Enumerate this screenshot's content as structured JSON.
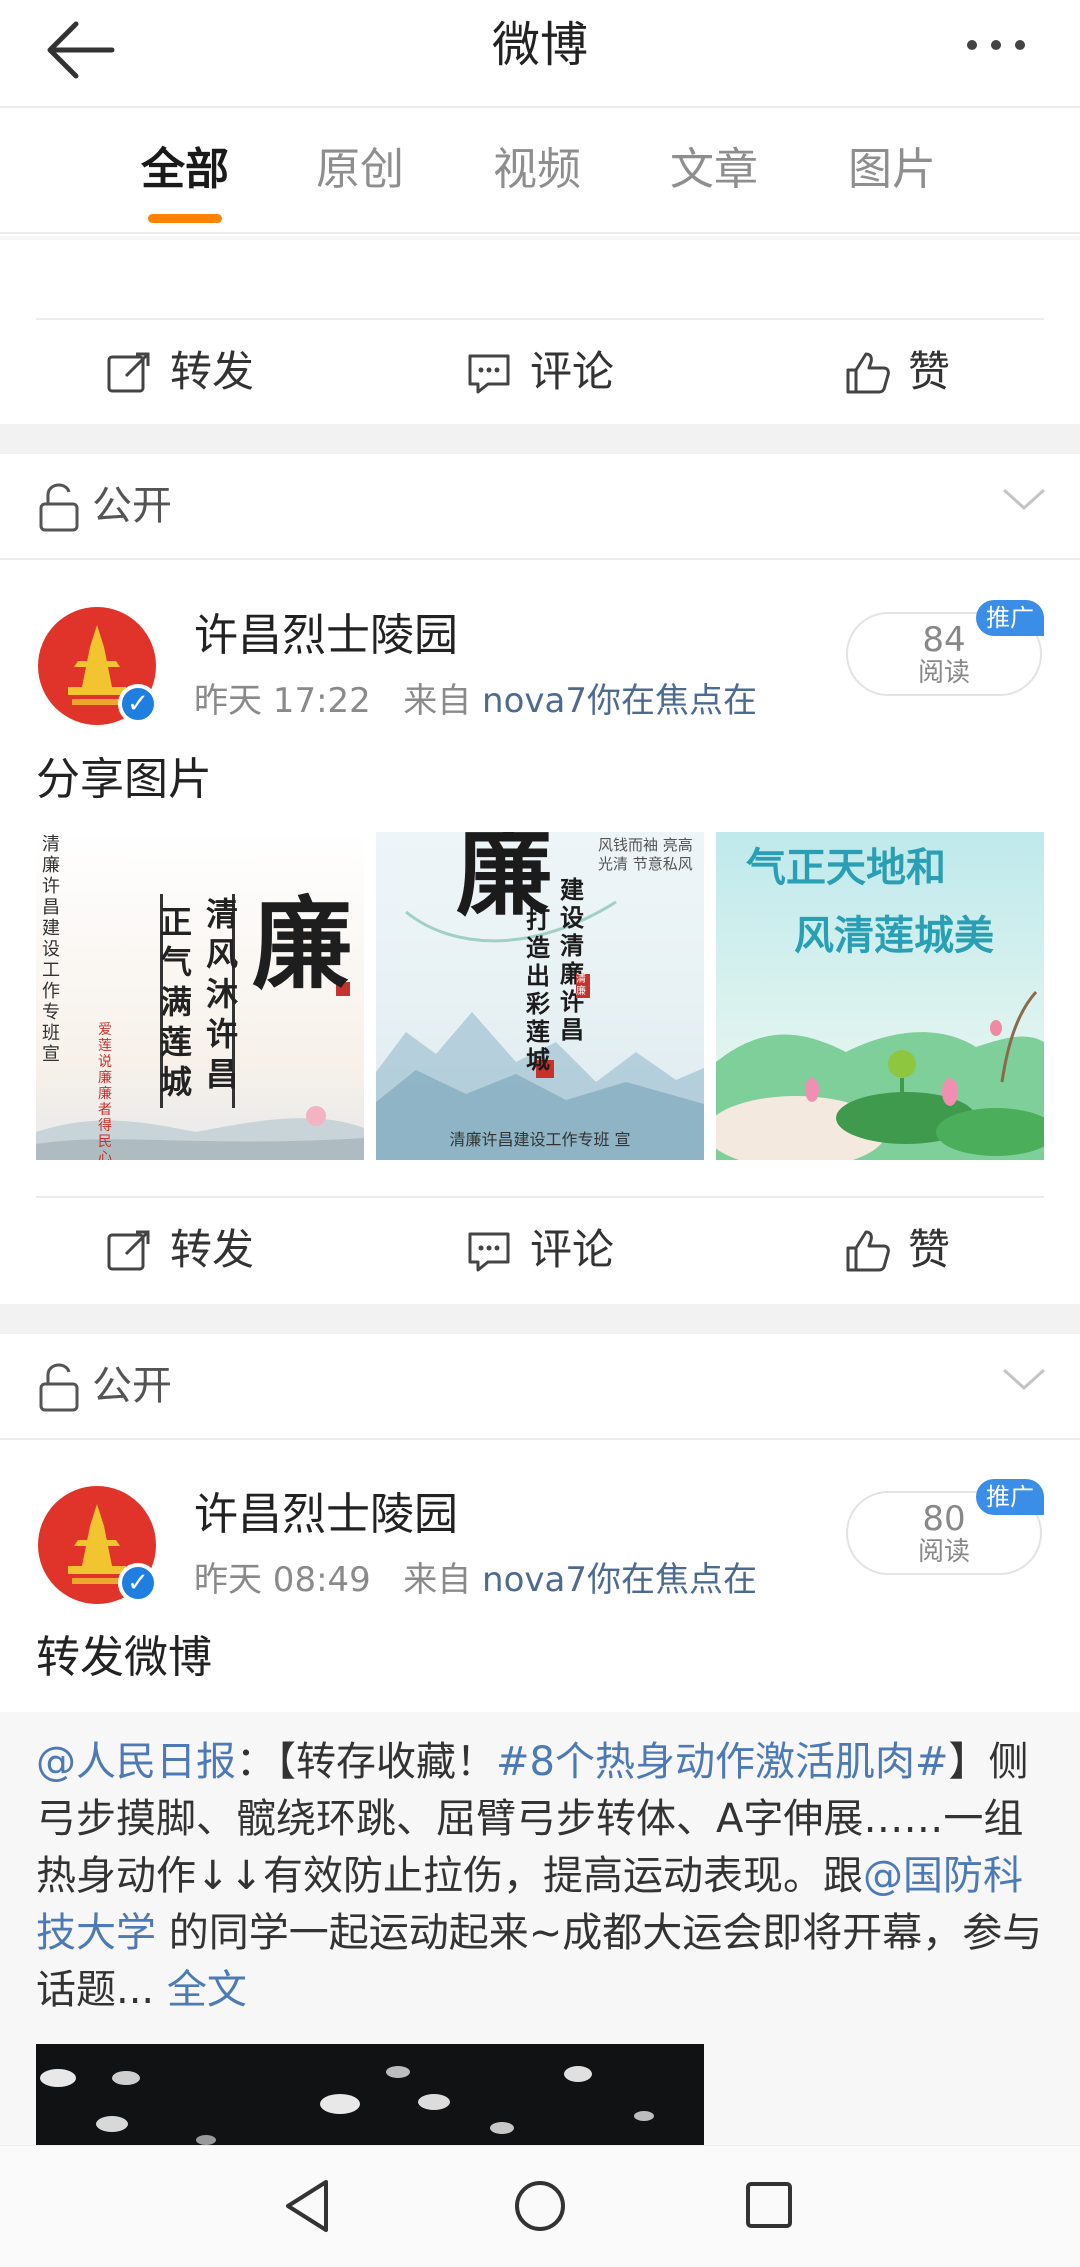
{
  "header": {
    "title": "微博"
  },
  "tabs": [
    {
      "label": "全部",
      "active": true
    },
    {
      "label": "原创",
      "active": false
    },
    {
      "label": "视频",
      "active": false
    },
    {
      "label": "文章",
      "active": false
    },
    {
      "label": "图片",
      "active": false
    }
  ],
  "actions": {
    "repost": "转发",
    "comment": "评论",
    "like": "赞"
  },
  "privacy": {
    "label": "公开"
  },
  "posts": [
    {
      "author": "许昌烈士陵园",
      "time": "昨天 17:22",
      "from_prefix": "来自",
      "source": "nova7你在焦点在",
      "reads": "84",
      "reads_label": "阅读",
      "promo": "推广",
      "text": "分享图片",
      "images": [
        {
          "name": "lian-poster-1",
          "side_text": "清廉许昌建设工作专班 宣",
          "col1": "清风沐许昌",
          "col2": "正气满莲城",
          "big": "廉",
          "small": "爱莲说廉 廉者得民心"
        },
        {
          "name": "lian-poster-2",
          "big": "廉",
          "col_a": "建设清廉许昌",
          "col_b": "打造出彩莲城",
          "verse": "风钱而袖 亮高光清 节意私风",
          "footer": "清廉许昌建设工作专班 宣",
          "seal": "清廉"
        },
        {
          "name": "lian-poster-3",
          "line1": "气正天地和",
          "line2": "风清莲城美"
        }
      ]
    },
    {
      "author": "许昌烈士陵园",
      "time": "昨天 08:49",
      "from_prefix": "来自",
      "source": "nova7你在焦点在",
      "reads": "80",
      "reads_label": "阅读",
      "promo": "推广",
      "text": "转发微博",
      "repost": {
        "mention": "@人民日报",
        "colon": "：【转存收藏！",
        "hashtag": "#8个热身动作激活肌肉#",
        "body1": "】侧弓步摸脚、髋绕环跳、屈臂弓步转体、A字伸展……一组热身动作↓↓有效防止拉伤，提高运动表现。跟",
        "mention2": "@国防科技大学",
        "body2": " 的同学一起运动起来~成都大运会即将开幕，参与话题...",
        "more": "全文"
      }
    }
  ]
}
